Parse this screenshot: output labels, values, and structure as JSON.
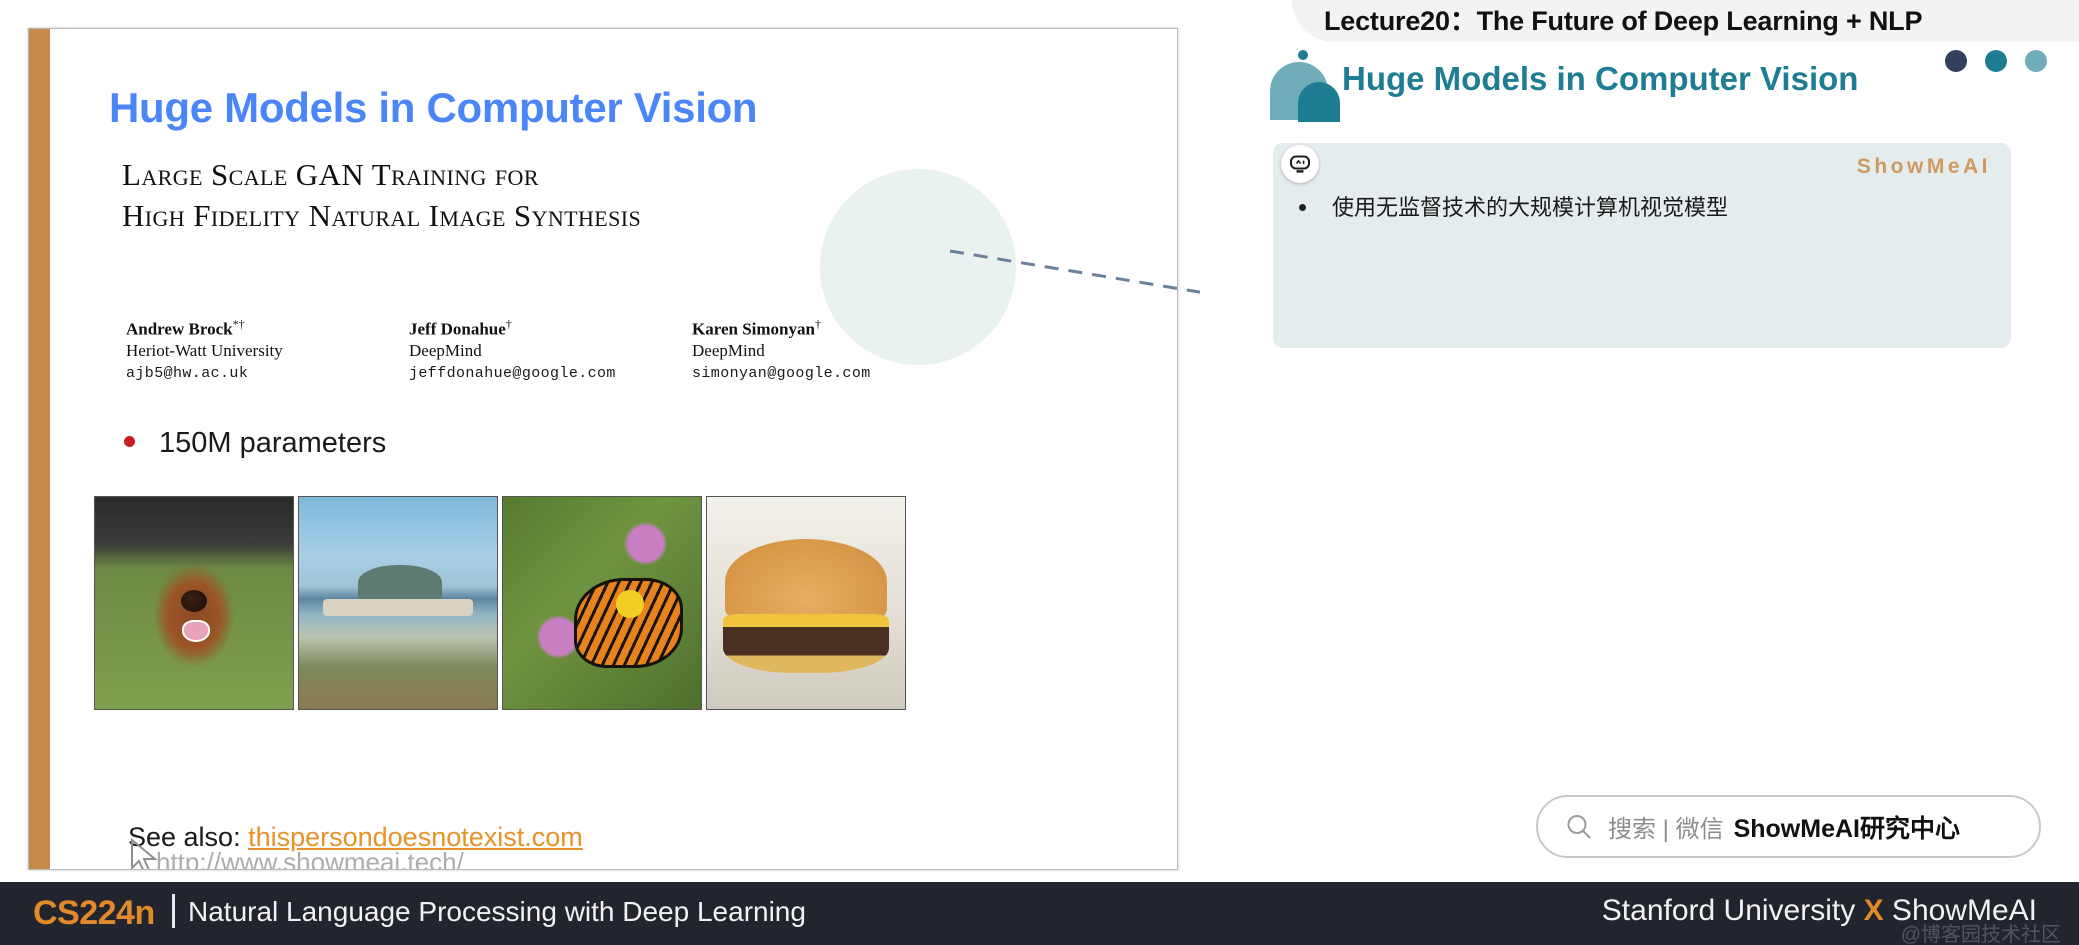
{
  "lecture": {
    "band_title": "Lecture20：The Future of Deep Learning + NLP"
  },
  "right_panel": {
    "header_title": "Huge Models in Computer Vision",
    "dots": [
      {
        "name": "dot-dark",
        "color": "#33405c"
      },
      {
        "name": "dot-teal",
        "color": "#1f7d93"
      },
      {
        "name": "dot-light",
        "color": "#6fadba"
      }
    ],
    "card": {
      "ai_badge_label": "AI",
      "watermark": "ShowMeAI",
      "bullets": [
        "使用无监督技术的大规模计算机视觉模型"
      ]
    },
    "search": {
      "icon": "search-icon",
      "placeholder": "搜索 | 微信",
      "account": "ShowMeAI研究中心"
    }
  },
  "slide": {
    "title": "Huge Models in Computer Vision",
    "paper": {
      "title_line1": "Large Scale GAN Training for",
      "title_line2": "High Fidelity Natural Image Synthesis",
      "authors": [
        {
          "name": "Andrew Brock",
          "marks": "*†",
          "affiliation": "Heriot-Watt University",
          "email": "ajb5@hw.ac.uk"
        },
        {
          "name": "Jeff Donahue",
          "marks": "†",
          "affiliation": "DeepMind",
          "email": "jeffdonahue@google.com"
        },
        {
          "name": "Karen Simonyan",
          "marks": "†",
          "affiliation": "DeepMind",
          "email": "simonyan@google.com"
        }
      ]
    },
    "bullets": [
      "150M parameters"
    ],
    "images": [
      {
        "name": "gan-sample-dog",
        "alt": "Irish setter dog"
      },
      {
        "name": "gan-sample-coastline",
        "alt": "Coastal headland landscape"
      },
      {
        "name": "gan-sample-butterfly",
        "alt": "Monarch butterfly on flowers"
      },
      {
        "name": "gan-sample-burger",
        "alt": "Cheeseburger on a plate"
      }
    ],
    "see_also": {
      "prefix": "See also: ",
      "link": "thispersondoesnotexist.com"
    },
    "watermark_url": "http://www.showmeai.tech/"
  },
  "bottom_bar": {
    "course_code": "CS224n",
    "course_subtitle": "Natural Language Processing with Deep Learning",
    "partner_left": "Stanford University ",
    "partner_x": "X",
    "partner_right": " ShowMeAI",
    "watermark": "@博客园技术社区"
  },
  "colors": {
    "slide_title_blue": "#4a86f7",
    "slide_accent_bar": "#c68a4b",
    "panel_teal": "#1f7d93",
    "panel_card_bg": "#e5ecee",
    "link_orange": "#e8922a",
    "bar_dark": "#23252e",
    "bullet_red": "#cc1e1e"
  }
}
